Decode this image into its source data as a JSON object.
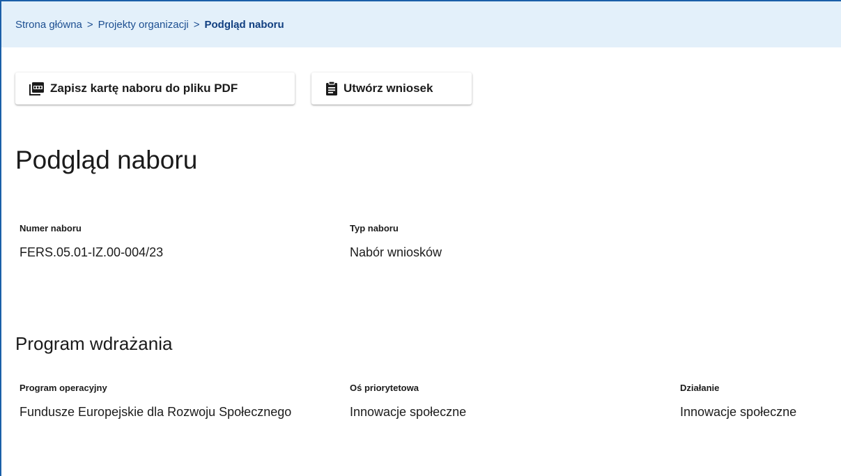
{
  "breadcrumb": {
    "items": [
      "Strona główna",
      "Projekty organizacji"
    ],
    "separator": ">",
    "current": "Podgląd naboru"
  },
  "toolbar": {
    "pdf_label": "Zapisz kartę naboru do pliku PDF",
    "pdf_icon": "pdf-icon",
    "create_label": "Utwórz wniosek",
    "create_icon": "clipboard-icon"
  },
  "page_title": "Podgląd naboru",
  "summary": {
    "number_label": "Numer naboru",
    "number_value": "FERS.05.01-IZ.00-004/23",
    "type_label": "Typ naboru",
    "type_value": "Nabór wniosków"
  },
  "program": {
    "section_title": "Program wdrażania",
    "op_label": "Program operacyjny",
    "op_value": "Fundusze Europejskie dla Rozwoju Społecznego",
    "axis_label": "Oś priorytetowa",
    "axis_value": "Innowacje społeczne",
    "action_label": "Działanie",
    "action_value": "Innowacje społeczne"
  },
  "colors": {
    "accent": "#1a5fa8",
    "breadcrumb_bg": "#e3f0fa",
    "link": "#1d4f91"
  }
}
